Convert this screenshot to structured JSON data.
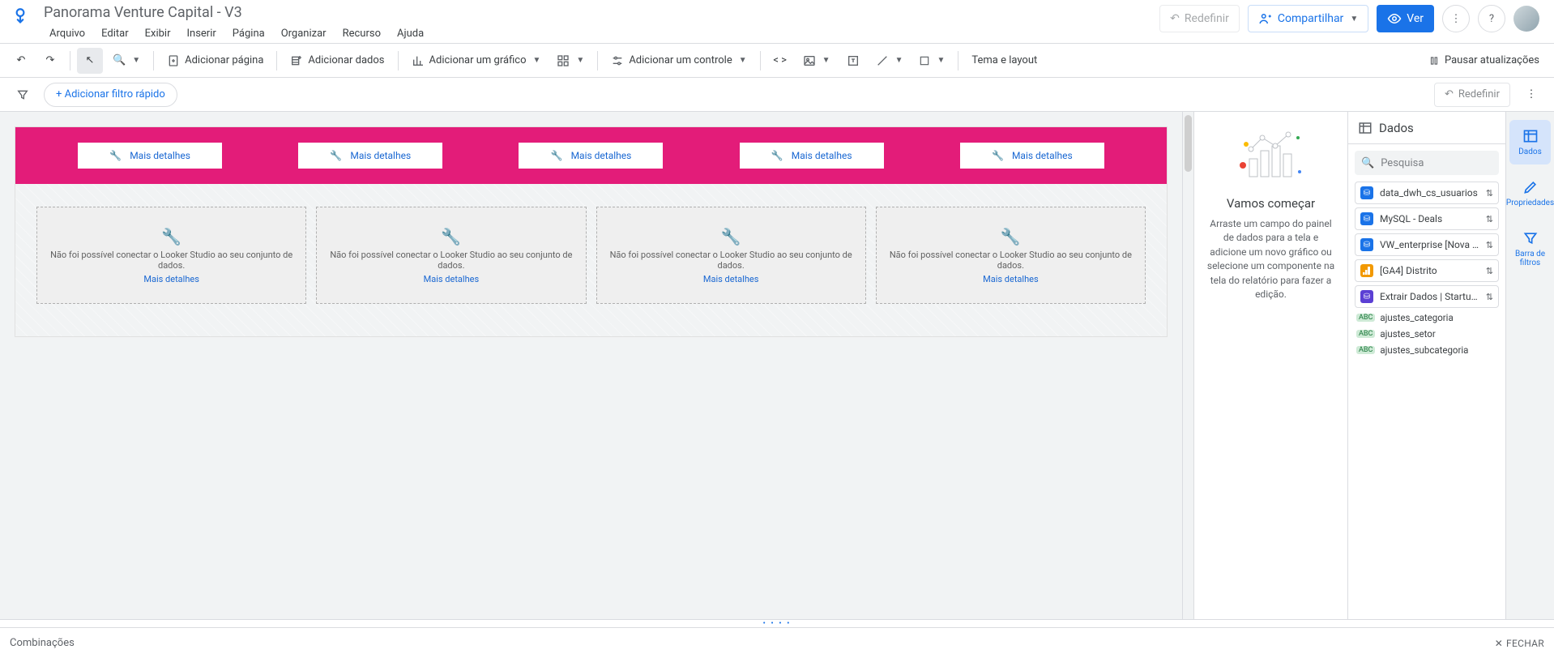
{
  "header": {
    "doc_title": "Panorama Venture Capital - V3",
    "menu": [
      "Arquivo",
      "Editar",
      "Exibir",
      "Inserir",
      "Página",
      "Organizar",
      "Recurso",
      "Ajuda"
    ],
    "reset": "Redefinir",
    "share": "Compartilhar",
    "view": "Ver"
  },
  "toolbar": {
    "add_page": "Adicionar página",
    "add_data": "Adicionar dados",
    "add_chart": "Adicionar um gráfico",
    "add_control": "Adicionar um controle",
    "theme": "Tema e layout",
    "pause": "Pausar atualizações"
  },
  "filterbar": {
    "add_filter": "+ Adicionar filtro rápido",
    "reset": "Redefinir"
  },
  "canvas": {
    "more_details": "Mais detalhes",
    "error_text": "Não foi possível conectar o Looker Studio ao seu conjunto de dados.",
    "error_details": "Mais detalhes"
  },
  "onboard": {
    "title": "Vamos começar",
    "body": "Arraste um campo do painel de dados para a tela e adicione um novo gráfico ou selecione um componente na tela do relatório para fazer a edição."
  },
  "datapanel": {
    "title": "Dados",
    "search_placeholder": "Pesquisa",
    "sources": [
      {
        "label": "data_dwh_cs_usuarios",
        "color": "#1a73e8",
        "icon": "db"
      },
      {
        "label": "MySQL - Deals",
        "color": "#1a73e8",
        "icon": "db"
      },
      {
        "label": "VW_enterprise [Nova Conexão]",
        "color": "#1a73e8",
        "icon": "db"
      },
      {
        "label": "[GA4] Distrito",
        "color": "#f29900",
        "icon": "ga"
      },
      {
        "label": "Extrair Dados | Startups Ativas",
        "color": "#5b3fd4",
        "icon": "ex"
      }
    ],
    "fields": [
      "ajustes_categoria",
      "ajustes_setor",
      "ajustes_subcategoria"
    ]
  },
  "rail": {
    "data": "Dados",
    "props": "Propriedades",
    "filters": "Barra de filtros"
  },
  "drawer": {
    "title": "Combinações",
    "close": "Fechar"
  }
}
